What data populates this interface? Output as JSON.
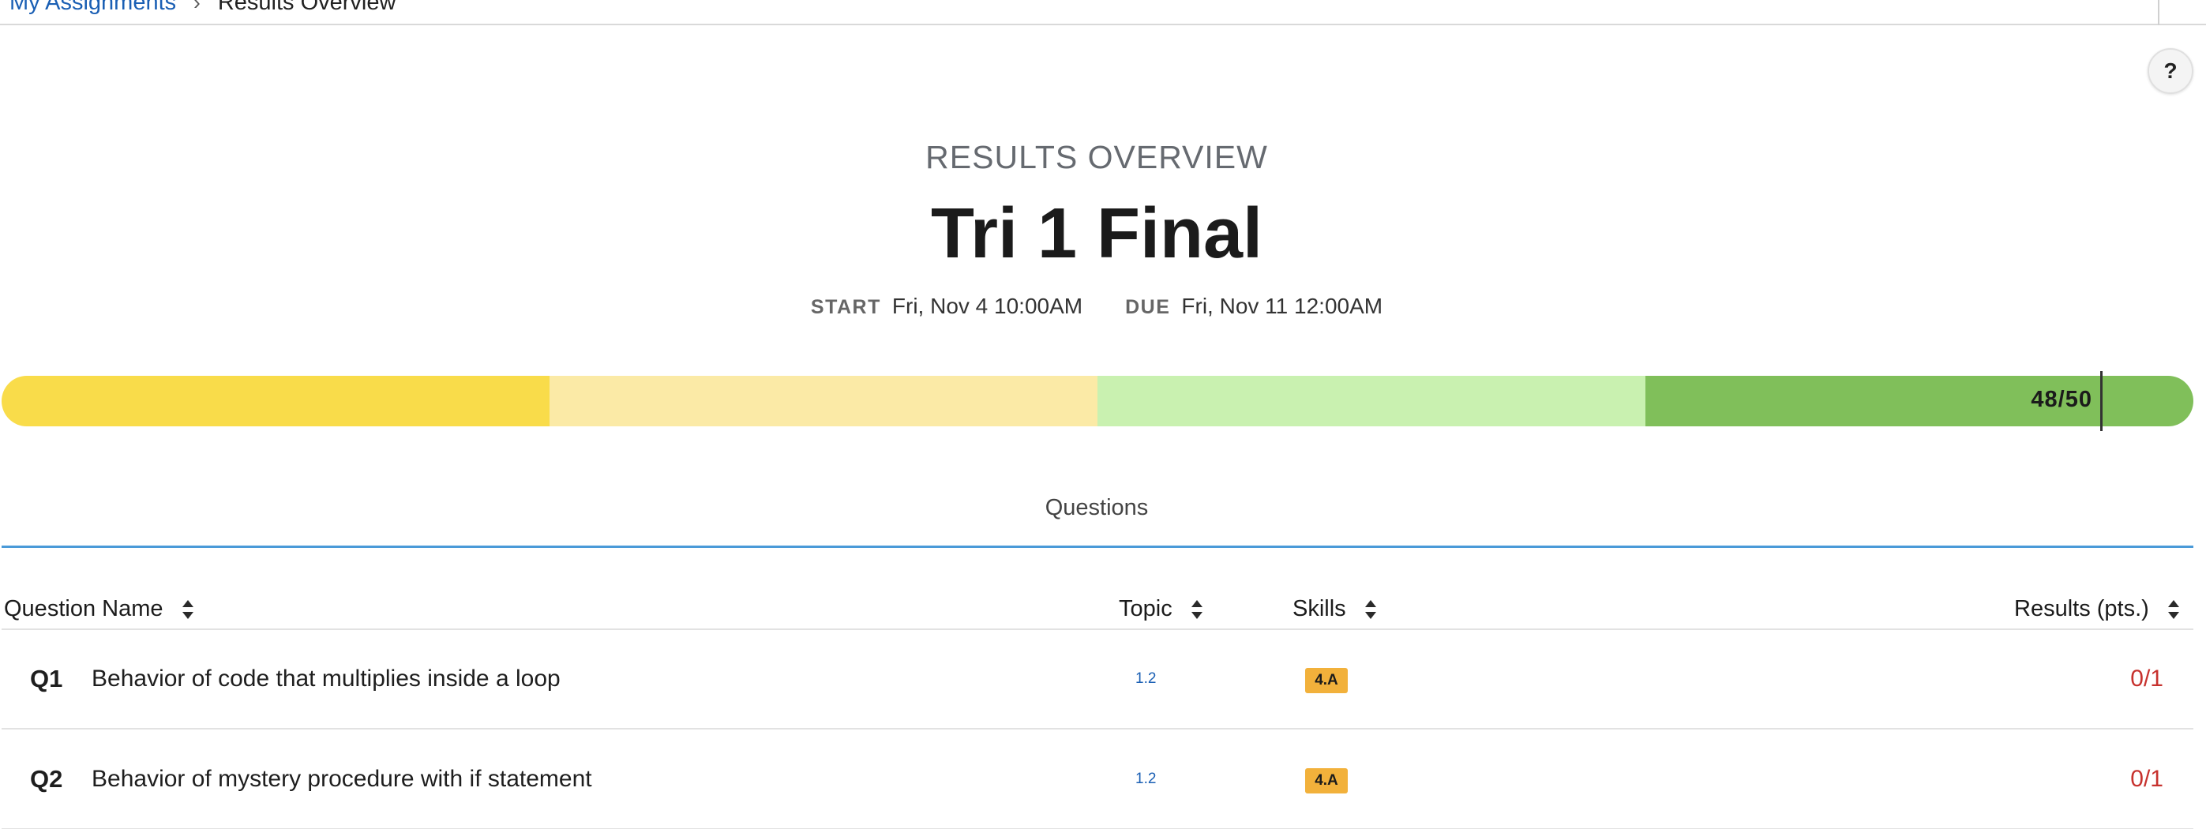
{
  "breadcrumb": {
    "parent": "My Assignments",
    "separator": "›",
    "current": "Results Overview"
  },
  "help": {
    "label": "?"
  },
  "header": {
    "eyebrow": "RESULTS OVERVIEW",
    "title": "Tri 1 Final",
    "start_label": "START",
    "start_value": "Fri, Nov 4 10:00AM",
    "due_label": "DUE",
    "due_value": "Fri, Nov 11 12:00AM"
  },
  "progress": {
    "score_text": "48/50",
    "score": 48,
    "max": 50,
    "segment_colors": [
      "#f9dc4a",
      "#fbeaa6",
      "#c9f1b0",
      "#80bf5a"
    ]
  },
  "section": {
    "tab_label": "Questions"
  },
  "table": {
    "columns": {
      "question_name": "Question Name",
      "topic": "Topic",
      "skills": "Skills",
      "results": "Results (pts.)"
    },
    "rows": [
      {
        "num": "Q1",
        "name": "Behavior of code that multiplies inside a loop",
        "topic": "1.2",
        "skill": "4.A",
        "result": "0/1"
      },
      {
        "num": "Q2",
        "name": "Behavior of mystery procedure with if statement",
        "topic": "1.2",
        "skill": "4.A",
        "result": "0/1"
      }
    ]
  },
  "colors": {
    "link": "#1a5fb4",
    "accent_rule": "#4a9ad8",
    "skill_badge": "#f2b13b",
    "result_wrong": "#c7322e"
  }
}
